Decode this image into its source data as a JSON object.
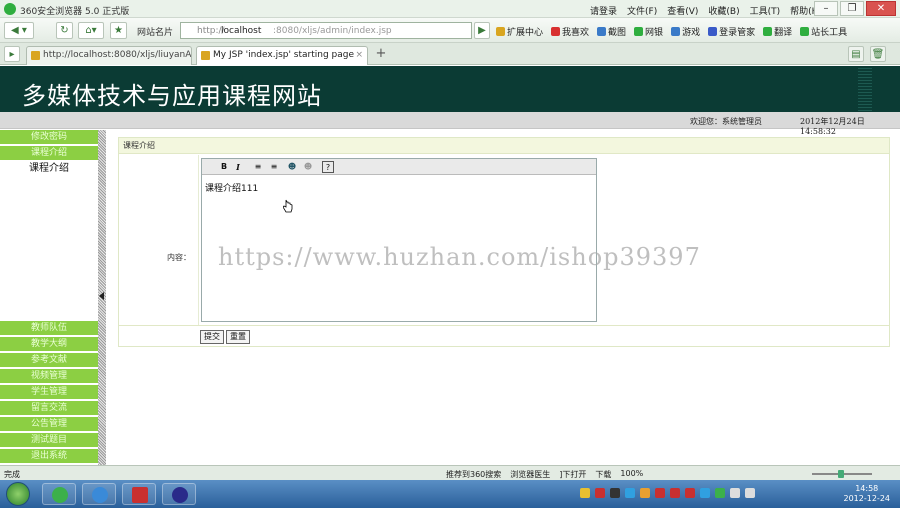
{
  "browser": {
    "title": "360安全浏览器 5.0 正式版",
    "menu": [
      "请登录",
      "文件(F)",
      "查看(V)",
      "收藏(B)",
      "工具(T)",
      "帮助(H)"
    ],
    "window_buttons": [
      "–",
      "❐",
      "✕"
    ],
    "bookmarks_label": "网站名片",
    "url": {
      "scheme": "http://",
      "host": "localhost",
      "rest": ":8080/xljs/admin/index.jsp"
    },
    "toolbar": [
      {
        "label": "扩展中心",
        "icon": "extension-icon",
        "color": "#d9a520"
      },
      {
        "label": "我喜欢",
        "icon": "heart-icon",
        "color": "#d83030"
      },
      {
        "label": "截图",
        "icon": "screenshot-icon",
        "color": "#3a7ac8"
      },
      {
        "label": "网银",
        "icon": "bank-icon",
        "color": "#2fae3f"
      },
      {
        "label": "游戏",
        "icon": "game-icon",
        "color": "#3a7ac8"
      },
      {
        "label": "登录管家",
        "icon": "key-icon",
        "color": "#3a5ac8"
      },
      {
        "label": "翻译",
        "icon": "translate-icon",
        "color": "#2fae3f"
      },
      {
        "label": "站长工具",
        "icon": "tools-icon",
        "color": "#2fae3f"
      }
    ],
    "tabs": [
      {
        "label": "http://localhost:8080/xljs/liuyanAll...",
        "active": false
      },
      {
        "label": "My JSP 'index.jsp' starting page",
        "active": true
      }
    ],
    "new_tab": "+"
  },
  "site": {
    "title": "多媒体技术与应用课程网站",
    "welcome": "欢迎您：系统管理员",
    "datetime": "2012年12月24日  14:58:32"
  },
  "sidebar": {
    "items_top": [
      "修改密码",
      "课程介绍"
    ],
    "active_item": "课程介绍",
    "items_bottom": [
      "教师队伍",
      "教学大纲",
      "参考文献",
      "视频管理",
      "学生管理",
      "留言交流",
      "公告管理",
      "测试题目",
      "退出系统"
    ]
  },
  "panel": {
    "heading": "课程介绍",
    "content_label": "内容：",
    "editor_text": "课程介绍111",
    "editor_tools": [
      "B",
      "I",
      "≡",
      "≡",
      "☻",
      "☻",
      "?"
    ],
    "submit_label": "提交",
    "reset_label": "重置"
  },
  "watermark": "https://www.huzhan.com/ishop39397",
  "statusbar": {
    "status": "完成",
    "items": [
      "推荐到360搜索",
      "浏览器医生",
      "]下打开",
      "下载",
      "100%"
    ],
    "zoom": "100%"
  },
  "taskbar": {
    "time": "14:58",
    "date": "2012-12-24"
  }
}
